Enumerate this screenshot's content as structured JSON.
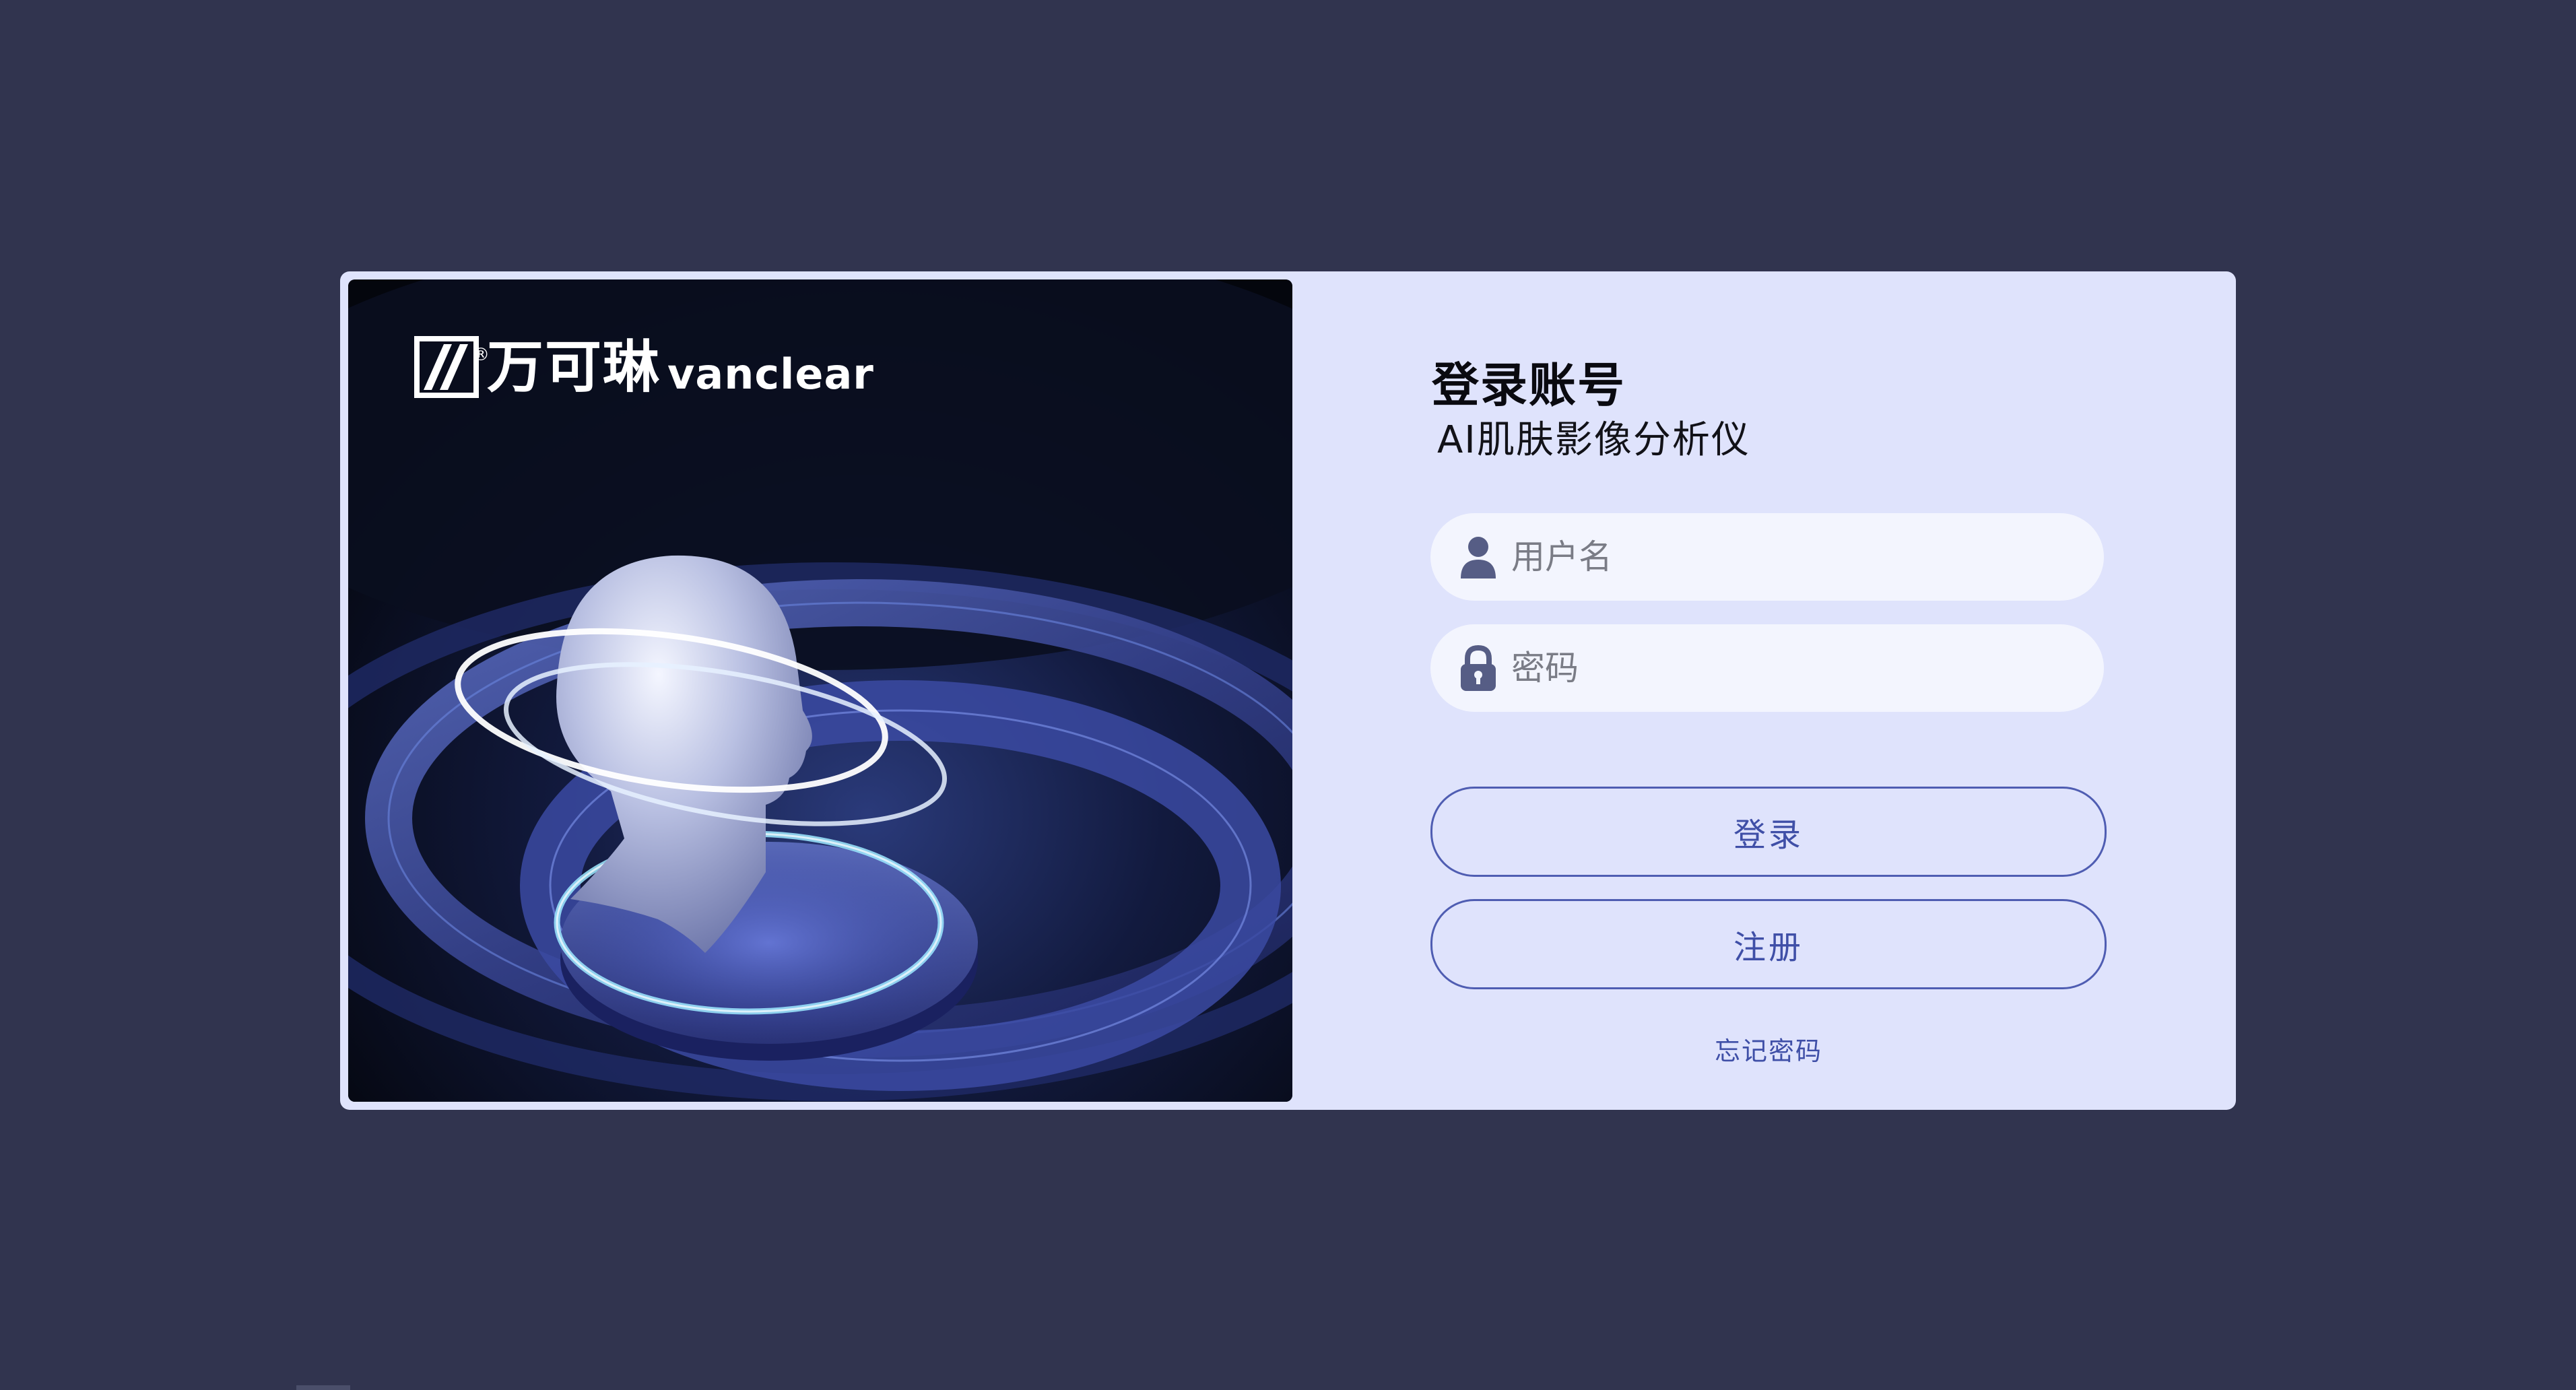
{
  "brand": {
    "name_cn": "万可琳",
    "name_en": "vanclear",
    "registered_mark": "®"
  },
  "login": {
    "title": "登录账号",
    "subtitle": "AI肌肤影像分析仪",
    "username": {
      "placeholder": "用户名",
      "value": "",
      "icon": "user-icon"
    },
    "password": {
      "placeholder": "密码",
      "value": "",
      "icon": "lock-icon"
    },
    "login_button": "登录",
    "register_button": "注册",
    "forgot_password": "忘记密码"
  },
  "colors": {
    "page_background": "#31344f",
    "card_background": "#dfe3fc",
    "input_background": "#f3f5fe",
    "accent": "#3f4fa7",
    "icon": "#565d85"
  }
}
